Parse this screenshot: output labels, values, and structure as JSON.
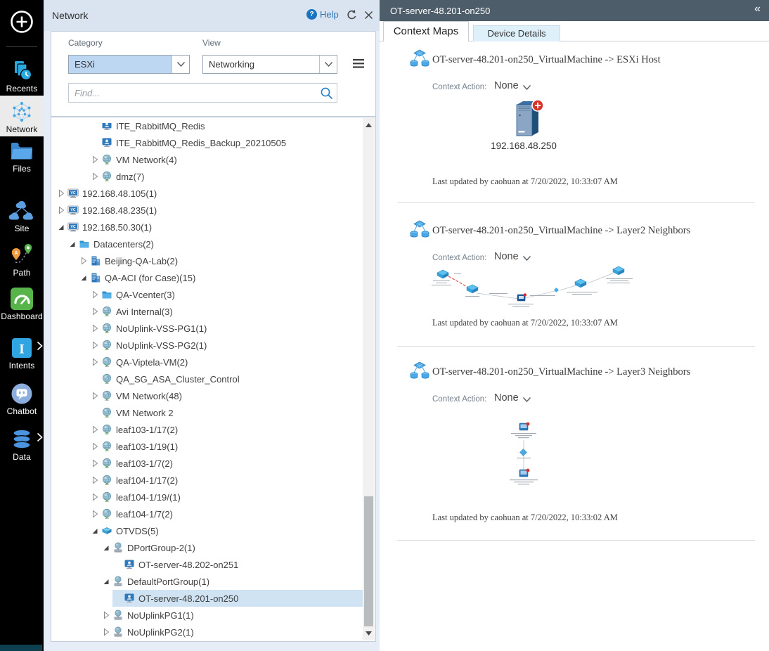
{
  "colors": {
    "accent_blue": "#2e78bb",
    "icon_blue": "#3fa3e8",
    "selection_bg": "#cfe3f2",
    "panel_bg": "#e7edf6",
    "panel_header_bg": "#dae4f1",
    "detail_header_bg": "#4e5d6a",
    "tab_inactive_bg": "#def0fa",
    "red_badge": "#d93025",
    "red_link": "#e0564a"
  },
  "icons": {
    "new": "plus-circle-icon",
    "help": "help-icon",
    "refresh": "refresh-icon",
    "close": "close-icon",
    "menu": "hamburger-icon",
    "search": "search-icon",
    "collapse": "collapse-left-icon",
    "section_map": "map-icon"
  },
  "sidebar": {
    "items": [
      {
        "name": "recents",
        "label": "Recents",
        "icon": "recents-icon",
        "active": false,
        "chevron": false
      },
      {
        "name": "network",
        "label": "Network",
        "icon": "network-icon",
        "active": true,
        "chevron": false
      },
      {
        "name": "files",
        "label": "Files",
        "icon": "files-icon",
        "active": false,
        "chevron": false
      },
      {
        "name": "site",
        "label": "Site",
        "icon": "site-icon",
        "active": false,
        "chevron": false
      },
      {
        "name": "path",
        "label": "Path",
        "icon": "path-icon",
        "active": false,
        "chevron": false
      },
      {
        "name": "dashboard",
        "label": "Dashboard",
        "icon": "dashboard-icon",
        "active": false,
        "chevron": false
      },
      {
        "name": "intents",
        "label": "Intents",
        "icon": "intents-icon",
        "active": false,
        "chevron": true
      },
      {
        "name": "chatbot",
        "label": "Chatbot",
        "icon": "chatbot-icon",
        "active": false,
        "chevron": false
      },
      {
        "name": "data",
        "label": "Data",
        "icon": "data-icon",
        "active": false,
        "chevron": true
      }
    ]
  },
  "panel": {
    "title": "Network",
    "help_label": "Help",
    "category_label": "Category",
    "category_value": "ESXi",
    "view_label": "View",
    "view_value": "Networking",
    "find_placeholder": "Find..."
  },
  "tree": {
    "items": [
      {
        "label": "ITE_RabbitMQ_Redis",
        "icon": "vm-icon",
        "level": 3,
        "expander": "none",
        "selected": false
      },
      {
        "label": "ITE_RabbitMQ_Redis_Backup_20210505",
        "icon": "vm-icon",
        "level": 3,
        "expander": "none",
        "selected": false
      },
      {
        "label": "VM Network(4)",
        "icon": "globe-icon",
        "level": 3,
        "expander": "collapsed",
        "selected": false
      },
      {
        "label": "dmz(7)",
        "icon": "globe-icon",
        "level": 3,
        "expander": "collapsed",
        "selected": false
      },
      {
        "label": "192.168.48.105(1)",
        "icon": "vc-icon",
        "level": 0,
        "expander": "collapsed",
        "selected": false
      },
      {
        "label": "192.168.48.235(1)",
        "icon": "vc-icon",
        "level": 0,
        "expander": "collapsed",
        "selected": false
      },
      {
        "label": "192.168.50.30(1)",
        "icon": "vc-icon",
        "level": 0,
        "expander": "expanded",
        "selected": false
      },
      {
        "label": "Datacenters(2)",
        "icon": "folder-icon",
        "level": 1,
        "expander": "expanded",
        "selected": false
      },
      {
        "label": "Beijing-QA-Lab(2)",
        "icon": "building-icon",
        "level": 2,
        "expander": "collapsed",
        "selected": false
      },
      {
        "label": "QA-ACI (for Case)(15)",
        "icon": "building-icon",
        "level": 2,
        "expander": "expanded",
        "selected": false
      },
      {
        "label": "QA-Vcenter(3)",
        "icon": "folder-icon",
        "level": 3,
        "expander": "collapsed",
        "selected": false
      },
      {
        "label": "Avi Internal(3)",
        "icon": "globe-icon",
        "level": 3,
        "expander": "collapsed",
        "selected": false
      },
      {
        "label": "NoUplink-VSS-PG1(1)",
        "icon": "globe-icon",
        "level": 3,
        "expander": "collapsed",
        "selected": false
      },
      {
        "label": "NoUplink-VSS-PG2(1)",
        "icon": "globe-icon",
        "level": 3,
        "expander": "collapsed",
        "selected": false
      },
      {
        "label": "QA-Viptela-VM(2)",
        "icon": "globe-icon",
        "level": 3,
        "expander": "collapsed",
        "selected": false
      },
      {
        "label": "QA_SG_ASA_Cluster_Control",
        "icon": "globe-icon",
        "level": 3,
        "expander": "none",
        "selected": false
      },
      {
        "label": "VM Network(48)",
        "icon": "globe-icon",
        "level": 3,
        "expander": "collapsed",
        "selected": false
      },
      {
        "label": "VM Network 2",
        "icon": "globe-icon",
        "level": 3,
        "expander": "none",
        "selected": false
      },
      {
        "label": "leaf103-1/17(2)",
        "icon": "globe-icon",
        "level": 3,
        "expander": "collapsed",
        "selected": false
      },
      {
        "label": "leaf103-1/19(1)",
        "icon": "globe-icon",
        "level": 3,
        "expander": "collapsed",
        "selected": false
      },
      {
        "label": "leaf103-1/7(2)",
        "icon": "globe-icon",
        "level": 3,
        "expander": "collapsed",
        "selected": false
      },
      {
        "label": "leaf104-1/17(2)",
        "icon": "globe-icon",
        "level": 3,
        "expander": "collapsed",
        "selected": false
      },
      {
        "label": "leaf104-1/19/(1)",
        "icon": "globe-icon",
        "level": 3,
        "expander": "collapsed",
        "selected": false
      },
      {
        "label": "leaf104-1/7(2)",
        "icon": "globe-icon",
        "level": 3,
        "expander": "collapsed",
        "selected": false
      },
      {
        "label": "OTVDS(5)",
        "icon": "dswitch-icon",
        "level": 3,
        "expander": "expanded",
        "selected": false
      },
      {
        "label": "DPortGroup-2(1)",
        "icon": "portgroup-icon",
        "level": 4,
        "expander": "expanded",
        "selected": false
      },
      {
        "label": "OT-server-48.202-on251",
        "icon": "vm-icon",
        "level": 5,
        "expander": "none",
        "selected": false
      },
      {
        "label": "DefaultPortGroup(1)",
        "icon": "portgroup-icon",
        "level": 4,
        "expander": "expanded",
        "selected": false
      },
      {
        "label": "OT-server-48.201-on250",
        "icon": "vm-icon",
        "level": 5,
        "expander": "none",
        "selected": true
      },
      {
        "label": "NoUplinkPG1(1)",
        "icon": "portgroup-icon",
        "level": 4,
        "expander": "collapsed",
        "selected": false
      },
      {
        "label": "NoUplinkPG2(1)",
        "icon": "portgroup-icon",
        "level": 4,
        "expander": "collapsed",
        "selected": false
      }
    ]
  },
  "detail": {
    "title": "OT-server-48.201-on250",
    "collapse_icon": "«",
    "tabs": [
      {
        "label": "Context Maps",
        "active": true
      },
      {
        "label": "Device Details",
        "active": false
      }
    ],
    "context_action_label": "Context Action:",
    "sections": [
      {
        "title": "OT-server-48.201-on250_VirtualMachine -> ESXi Host",
        "action_value": "None",
        "thumb": "esxi-host",
        "device_label": "192.168.48.250",
        "last_updated": "Last updated by caohuan at 7/20/2022, 10:33:07 AM"
      },
      {
        "title": "OT-server-48.201-on250_VirtualMachine -> Layer2 Neighbors",
        "action_value": "None",
        "thumb": "layer2",
        "last_updated": "Last updated by caohuan at 7/20/2022, 10:33:07 AM"
      },
      {
        "title": "OT-server-48.201-on250_VirtualMachine -> Layer3 Neighbors",
        "action_value": "None",
        "thumb": "layer3",
        "last_updated": "Last updated by caohuan at 7/20/2022, 10:33:02 AM"
      }
    ]
  }
}
